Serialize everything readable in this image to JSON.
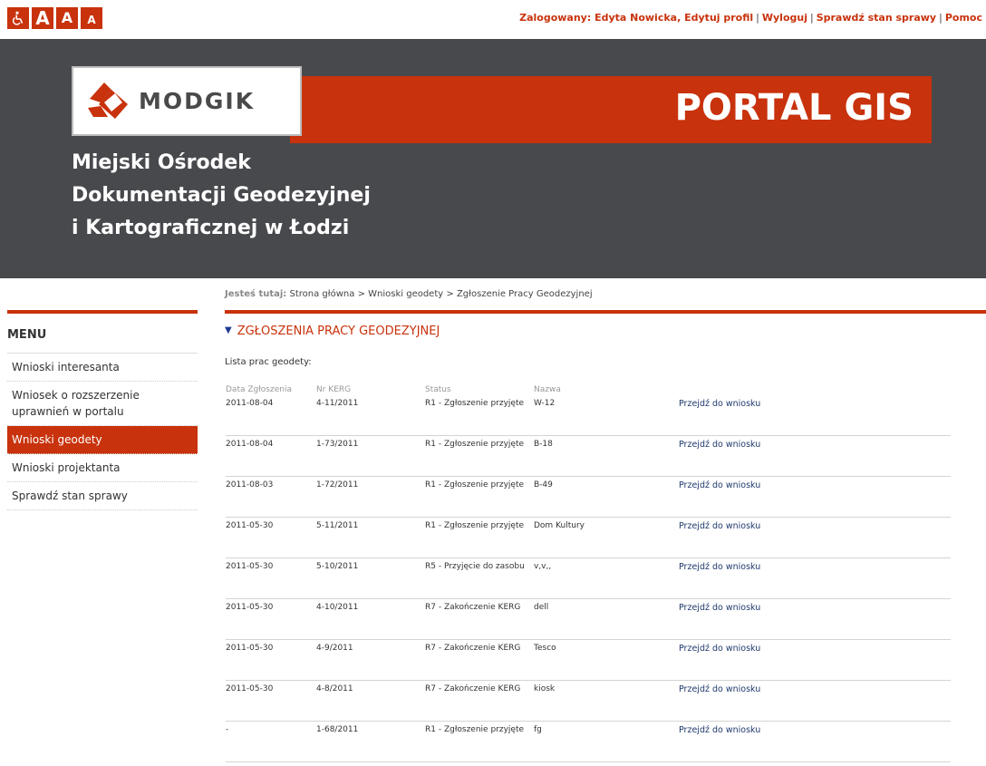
{
  "topbar": {
    "a_large": "A",
    "a_medium": "A",
    "a_small": "A",
    "logged_in": "Zalogowany: Edyta Nowicka,",
    "edit_profile": "Edytuj profil",
    "logout": "Wyloguj",
    "check_status": "Sprawdź stan sprawy",
    "help": "Pomoc",
    "separator": "|"
  },
  "header": {
    "logo_text": "MODGIK",
    "portal_title": "PORTAL GIS",
    "org_line1": "Miejski Ośrodek",
    "org_line2": "Dokumentacji Geodezyjnej",
    "org_line3": "i Kartograficznej w Łodzi",
    "brand_color": "#c8320c",
    "header_bg": "#48494d"
  },
  "breadcrumb": {
    "label": "Jesteś tutaj:",
    "home": "Strona główna",
    "sep": ">",
    "section": "Wnioski geodety",
    "current": "Zgłoszenie Pracy Geodezyjnej"
  },
  "sidebar": {
    "title": "MENU",
    "items": [
      {
        "label": "Wnioski interesanta"
      },
      {
        "label": "Wniosek o rozszerzenie uprawnień w portalu"
      },
      {
        "label": "Wnioski geodety"
      },
      {
        "label": "Wnioski projektanta"
      },
      {
        "label": "Sprawdź stan sprawy"
      }
    ]
  },
  "main": {
    "section_title": "ZGŁOSZENIA PRACY GEODEZYJNEJ",
    "list_caption": "Lista prac geodety:",
    "columns": [
      "Data Zgłoszenia",
      "Nr KERG",
      "Status",
      "Nazwa"
    ],
    "rows": [
      {
        "date": "2011-08-04",
        "nr": "4-11/2011",
        "status": "R1 - Zgłoszenie przyjęte",
        "name": "W-12",
        "link": "Przejdź do wniosku"
      },
      {
        "date": "2011-08-04",
        "nr": "1-73/2011",
        "status": "R1 - Zgłoszenie przyjęte",
        "name": "B-18",
        "link": "Przejdź do wniosku"
      },
      {
        "date": "2011-08-03",
        "nr": "1-72/2011",
        "status": "R1 - Zgłoszenie przyjęte",
        "name": "B-49",
        "link": "Przejdź do wniosku"
      },
      {
        "date": "2011-05-30",
        "nr": "5-11/2011",
        "status": "R1 - Zgłoszenie przyjęte",
        "name": "Dom Kultury",
        "link": "Przejdź do wniosku"
      },
      {
        "date": "2011-05-30",
        "nr": "5-10/2011",
        "status": "R5 - Przyjęcie do zasobu",
        "name": "v,v,,",
        "link": "Przejdź do wniosku"
      },
      {
        "date": "2011-05-30",
        "nr": "4-10/2011",
        "status": "R7 - Zakończenie KERG",
        "name": "dell",
        "link": "Przejdź do wniosku"
      },
      {
        "date": "2011-05-30",
        "nr": "4-9/2011",
        "status": "R7 - Zakończenie KERG",
        "name": "Tesco",
        "link": "Przejdź do wniosku"
      },
      {
        "date": "2011-05-30",
        "nr": "4-8/2011",
        "status": "R7 - Zakończenie KERG",
        "name": "kiosk",
        "link": "Przejdź do wniosku"
      },
      {
        "date": "-",
        "nr": "1-68/2011",
        "status": "R1 - Zgłoszenie przyjęte",
        "name": "fg",
        "link": "Przejdź do wniosku"
      }
    ]
  }
}
